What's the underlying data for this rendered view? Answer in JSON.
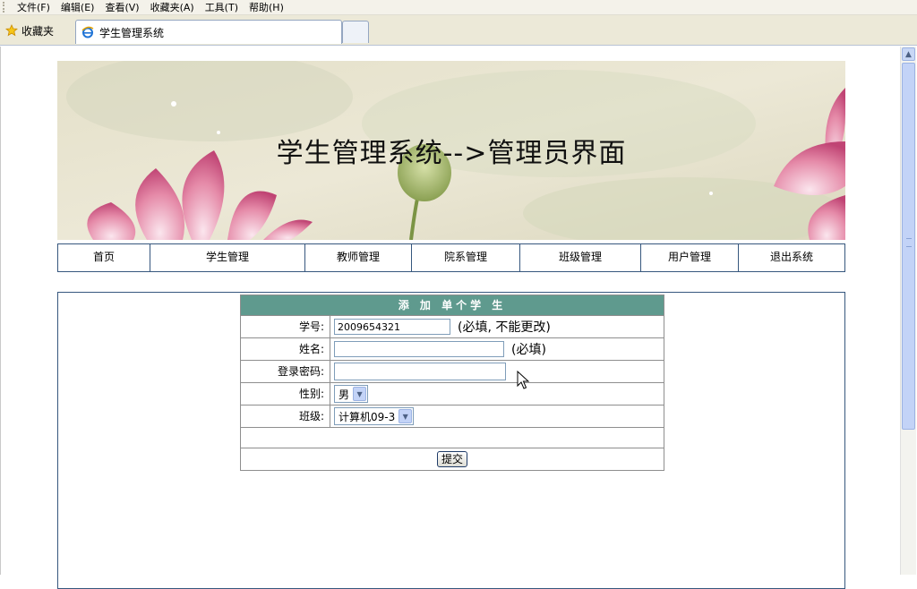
{
  "menubar": {
    "items": [
      "文件(F)",
      "编辑(E)",
      "查看(V)",
      "收藏夹(A)",
      "工具(T)",
      "帮助(H)"
    ]
  },
  "favorites": {
    "label": "收藏夹"
  },
  "tab": {
    "title": "学生管理系统"
  },
  "banner": {
    "title": "学生管理系统-->管理员界面"
  },
  "nav": {
    "items": [
      "首页",
      "学生管理",
      "教师管理",
      "院系管理",
      "班级管理",
      "用户管理",
      "退出系统"
    ]
  },
  "form": {
    "header": "添 加 单个学 生",
    "student_id_label": "学号:",
    "student_id_value": "2009654321",
    "student_id_note": "(必填, 不能更改)",
    "name_label": "姓名:",
    "name_value": "",
    "name_note": "(必填)",
    "password_label": "登录密码:",
    "password_value": "",
    "gender_label": "性别:",
    "gender_value": "男",
    "class_label": "班级:",
    "class_value": "计算机09-3",
    "submit_label": "提交"
  },
  "colors": {
    "form_header": "#5f9a8e",
    "nav_border": "#36577e"
  }
}
